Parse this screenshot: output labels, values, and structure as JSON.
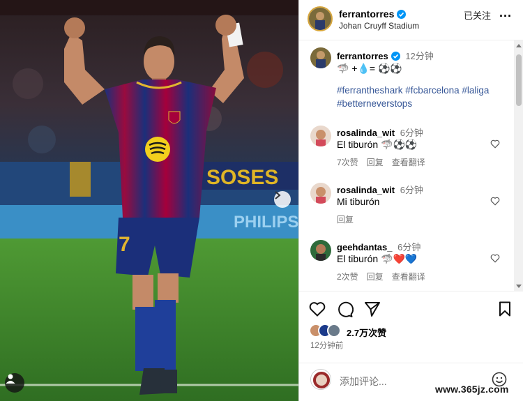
{
  "post": {
    "username": "ferrantorres",
    "location": "Johan Cruyff Stadium",
    "follow_label": "已关注",
    "more_label": "...",
    "photo_banner_text": "SOSES",
    "photo_board_text": "PHILIPS",
    "jersey_number": "7"
  },
  "caption": {
    "username": "ferrantorres",
    "time": "12分钟",
    "text": "🦈 +💧= ⚽⚽",
    "hashtags": "#ferrantheshark #fcbarcelona #laliga #betterneverstops"
  },
  "comments": [
    {
      "username": "rosalinda_wit",
      "time": "6分钟",
      "text": "El tiburón 🦈⚽⚽",
      "likes": "7次赞",
      "reply": "回复",
      "translate": "查看翻译"
    },
    {
      "username": "rosalinda_wit",
      "time": "6分钟",
      "text": "Mi tiburón",
      "likes": "",
      "reply": "回复",
      "translate": ""
    },
    {
      "username": "geehdantas_",
      "time": "6分钟",
      "text": "El tiburón 🦈❤️💙",
      "likes": "2次赞",
      "reply": "回复",
      "translate": "查看翻译"
    }
  ],
  "likes_count": "2.7万次赞",
  "posted_time": "12分钟前",
  "add_comment": {
    "placeholder": "添加评论..."
  },
  "watermark": "www.365jz.com",
  "colors": {
    "verified": "#0095f6",
    "hashtag": "#385898",
    "barca_blue": "#1b3a8a",
    "barca_red": "#a5003b",
    "pitch_green": "#3f8a2c"
  }
}
